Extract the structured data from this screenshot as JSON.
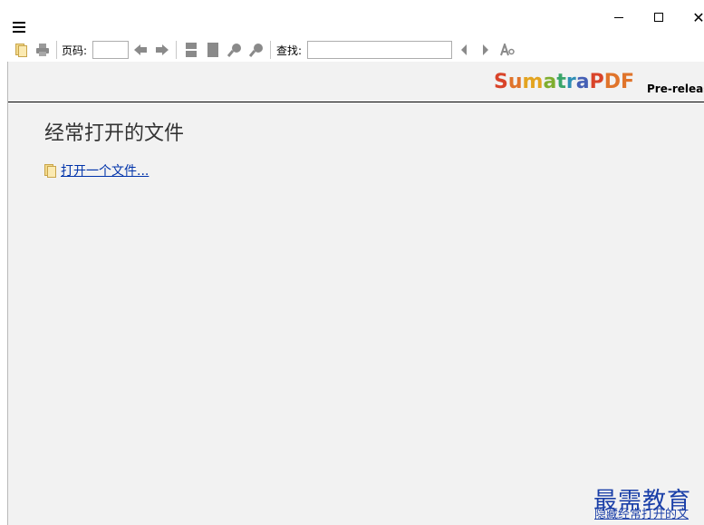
{
  "toolbar": {
    "page_label": "页码:",
    "page_value": "",
    "find_label": "查找:",
    "find_value": ""
  },
  "header": {
    "logo_letters": [
      {
        "ch": "S",
        "color": "#d9442a"
      },
      {
        "ch": "u",
        "color": "#e0742b"
      },
      {
        "ch": "m",
        "color": "#e3a420"
      },
      {
        "ch": "a",
        "color": "#7fae2f"
      },
      {
        "ch": "t",
        "color": "#3aa56a"
      },
      {
        "ch": "r",
        "color": "#2e8fb5"
      },
      {
        "ch": "a",
        "color": "#4560b5"
      },
      {
        "ch": "P",
        "color": "#d9442a"
      },
      {
        "ch": "D",
        "color": "#e0742b"
      },
      {
        "ch": "F",
        "color": "#e0742b"
      }
    ],
    "pre_release": "Pre-releas"
  },
  "main": {
    "title": "经常打开的文件",
    "open_file_link": "打开一个文件..."
  },
  "watermark": {
    "text": "最需教育",
    "subtext": "隐藏经常打开的文"
  },
  "icons": {
    "menu": "hamburger-menu-icon",
    "open": "open-folder-icon",
    "print": "printer-icon",
    "prev_page": "left-arrow-icon",
    "next_page": "right-arrow-icon",
    "continuous": "continuous-view-icon",
    "single": "single-page-icon",
    "zoom_out": "zoom-out-icon",
    "zoom_in": "zoom-in-icon",
    "find_prev": "find-previous-icon",
    "find_next": "find-next-icon",
    "match_case": "match-case-icon"
  }
}
